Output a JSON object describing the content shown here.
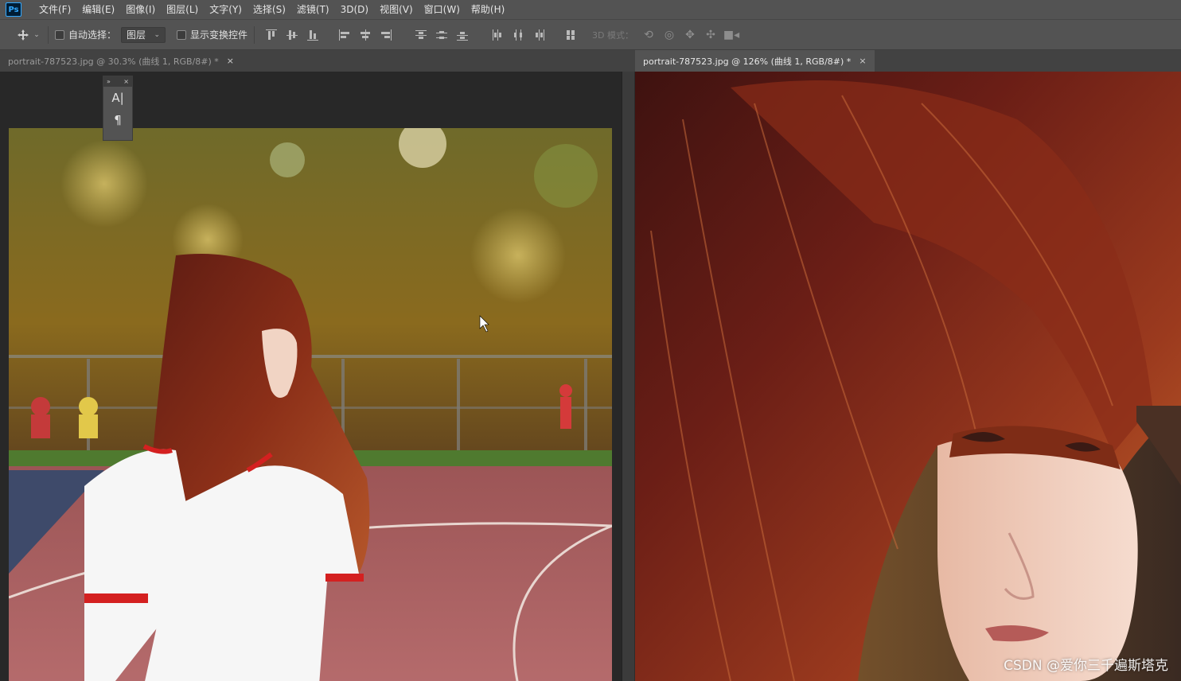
{
  "app": {
    "logo": "Ps"
  },
  "menu": [
    "文件(F)",
    "编辑(E)",
    "图像(I)",
    "图层(L)",
    "文字(Y)",
    "选择(S)",
    "滤镜(T)",
    "3D(D)",
    "视图(V)",
    "窗口(W)",
    "帮助(H)"
  ],
  "options_bar": {
    "auto_select_label": "自动选择：",
    "auto_select_checked": false,
    "layer_select_value": "图层",
    "show_transform_label": "显示变换控件",
    "show_transform_checked": false,
    "mode_3d_label": "3D 模式："
  },
  "documents": {
    "left": {
      "title": "portrait-787523.jpg @ 30.3% (曲线 1, RGB/8#) *",
      "close": "×",
      "active": false
    },
    "right": {
      "title": "portrait-787523.jpg @ 126% (曲线 1, RGB/8#) *",
      "close": "×",
      "active": true
    }
  },
  "mini_panel": {
    "collapse": "»",
    "close": "×",
    "character_glyph": "A|",
    "paragraph_glyph": "¶"
  },
  "watermark": "CSDN @爱你三千遍斯塔克",
  "colors": {
    "menubar": "#535353",
    "canvas_bg": "#282828",
    "ps_blue": "#31a8ff"
  }
}
